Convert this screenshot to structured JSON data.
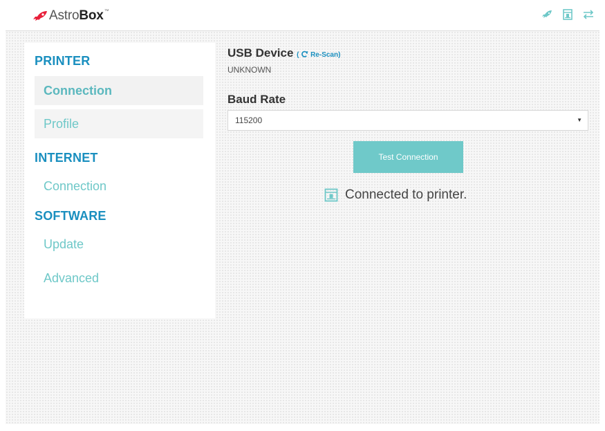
{
  "brand": {
    "name_light": "Astro",
    "name_bold": "Box",
    "trademark": "™",
    "accent_color": "#e8203a"
  },
  "header_icons": [
    {
      "name": "rocket-icon",
      "color": "#6ec8c8"
    },
    {
      "name": "printer-icon",
      "color": "#6ec8c8"
    },
    {
      "name": "transfer-icon",
      "color": "#6ec8c8"
    }
  ],
  "sidebar": {
    "sections": [
      {
        "heading": "PRINTER",
        "items": [
          {
            "label": "Connection",
            "active": true
          },
          {
            "label": "Profile",
            "active": false
          }
        ]
      },
      {
        "heading": "INTERNET",
        "items": [
          {
            "label": "Connection",
            "active": false
          }
        ]
      },
      {
        "heading": "SOFTWARE",
        "items": [
          {
            "label": "Update",
            "active": false
          },
          {
            "label": "Advanced",
            "active": false
          }
        ]
      }
    ]
  },
  "main": {
    "usb_label": "USB Device",
    "rescan_open": "(",
    "rescan_label": "Re-Scan)",
    "usb_value": "UNKNOWN",
    "baud_label": "Baud Rate",
    "baud_value": "115200",
    "test_button": "Test Connection",
    "status_text": "Connected to printer."
  },
  "colors": {
    "section_heading": "#1a8fbf",
    "nav_text": "#6ec8c8",
    "button": "#6fc9c9"
  }
}
